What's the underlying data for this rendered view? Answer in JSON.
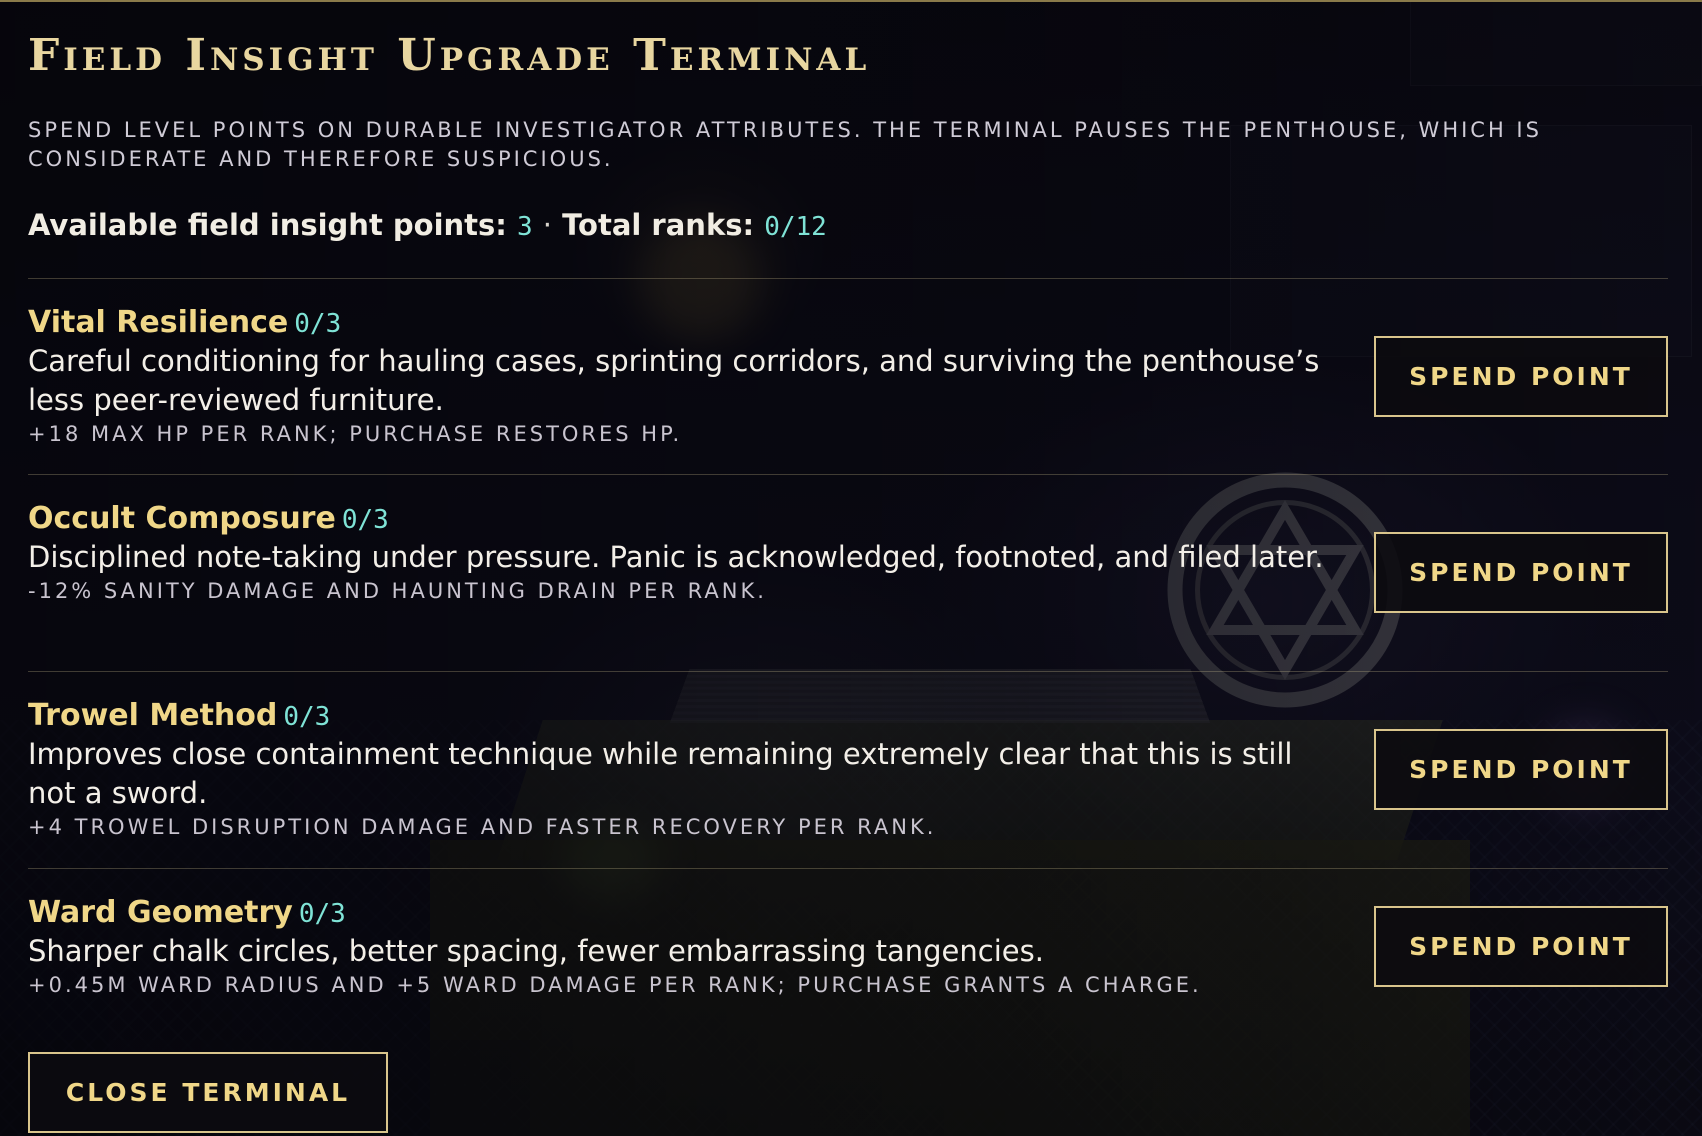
{
  "terminal": {
    "title": "Field Insight Upgrade Terminal",
    "subtitle": "Spend level points on durable investigator attributes. The terminal pauses the penthouse, which is considerate and therefore suspicious.",
    "points_label": "Available field insight points:",
    "points_value": "3",
    "separator": "·",
    "ranks_label": "Total ranks:",
    "ranks_value": "0/12",
    "close_label": "Close Terminal"
  },
  "upgrades": [
    {
      "name": "Vital Resilience",
      "rank": "0/3",
      "description": "Careful conditioning for hauling cases, sprinting corridors, and surviving the penthouse’s less peer-reviewed furniture.",
      "effect": "+18 max HP per rank; purchase restores HP.",
      "button_label": "Spend Point"
    },
    {
      "name": "Occult Composure",
      "rank": "0/3",
      "description": "Disciplined note-taking under pressure. Panic is acknowledged, footnoted, and filed later.",
      "effect": "-12% sanity damage and haunting drain per rank.",
      "button_label": "Spend Point"
    },
    {
      "name": "Trowel Method",
      "rank": "0/3",
      "description": "Improves close containment technique while remaining extremely clear that this is still not a sword.",
      "effect": "+4 trowel disruption damage and faster recovery per rank.",
      "button_label": "Spend Point"
    },
    {
      "name": "Ward Geometry",
      "rank": "0/3",
      "description": "Sharper chalk circles, better spacing, fewer embarrassing tangencies.",
      "effect": "+0.45m ward radius and +5 ward damage per rank; purchase grants a charge.",
      "button_label": "Spend Point"
    }
  ],
  "colors": {
    "title": "#e8d6a0",
    "upgrade_name": "#f0d788",
    "accent_value": "#7fe3d6",
    "button_border": "#d9c58c"
  }
}
